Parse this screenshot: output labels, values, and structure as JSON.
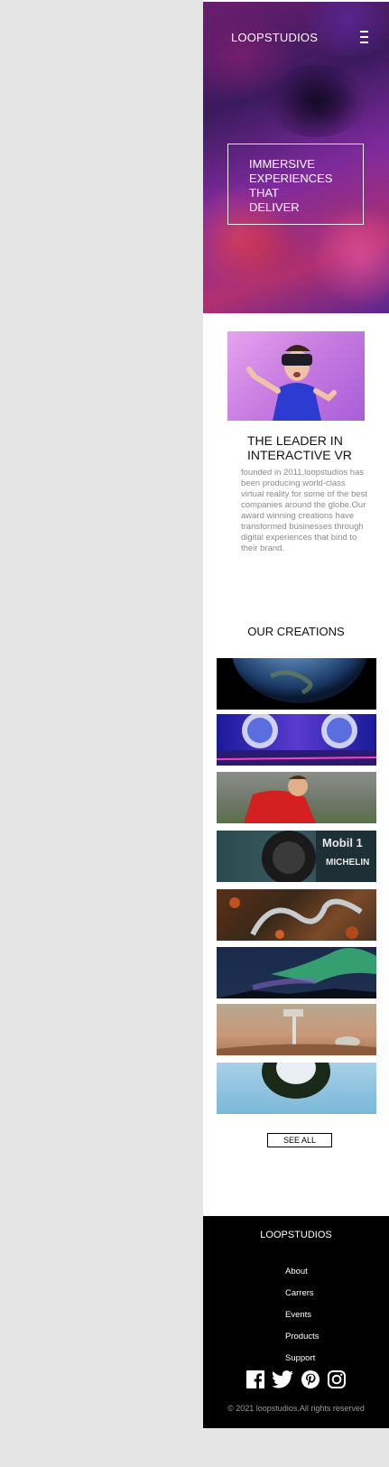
{
  "header": {
    "logo": "LOOPSTUDIOS",
    "menu_icon": "hamburger-menu-icon"
  },
  "hero": {
    "lines": [
      "IMMERSIVE",
      "EXPERIENCES",
      "THAT",
      "DELIVER"
    ]
  },
  "intro": {
    "title_lines": [
      "THE LEADER IN",
      "INTERACTIVE VR"
    ],
    "text": "founded in 2011,loopstudios has been producing world-class virtual reality for some of the best companies around the globe.Our award winning creations have transformed businesses through digital experiences that bind to their brand."
  },
  "creations": {
    "title": "OUR CREATIONS",
    "items": [
      "earth-image",
      "arcade-image",
      "soccer-image",
      "race-car-image",
      "curvy-road-image",
      "aurora-image",
      "rover-image",
      "fisheye-image"
    ],
    "see_all_label": "SEE ALL"
  },
  "footer": {
    "logo": "LOOPSTUDIOS",
    "links": [
      "About",
      "Carrers",
      "Events",
      "Products",
      "Support"
    ],
    "social_icons": [
      "facebook-icon",
      "twitter-icon",
      "pinterest-icon",
      "instagram-icon"
    ],
    "copyright": "© 2021 loopstudios.All rights reserved"
  },
  "colors": {
    "page_bg": "#e5e5e5",
    "content_bg": "#ffffff",
    "footer_bg": "#000000",
    "text_dark": "#111111",
    "text_muted": "#8a8a8a"
  }
}
